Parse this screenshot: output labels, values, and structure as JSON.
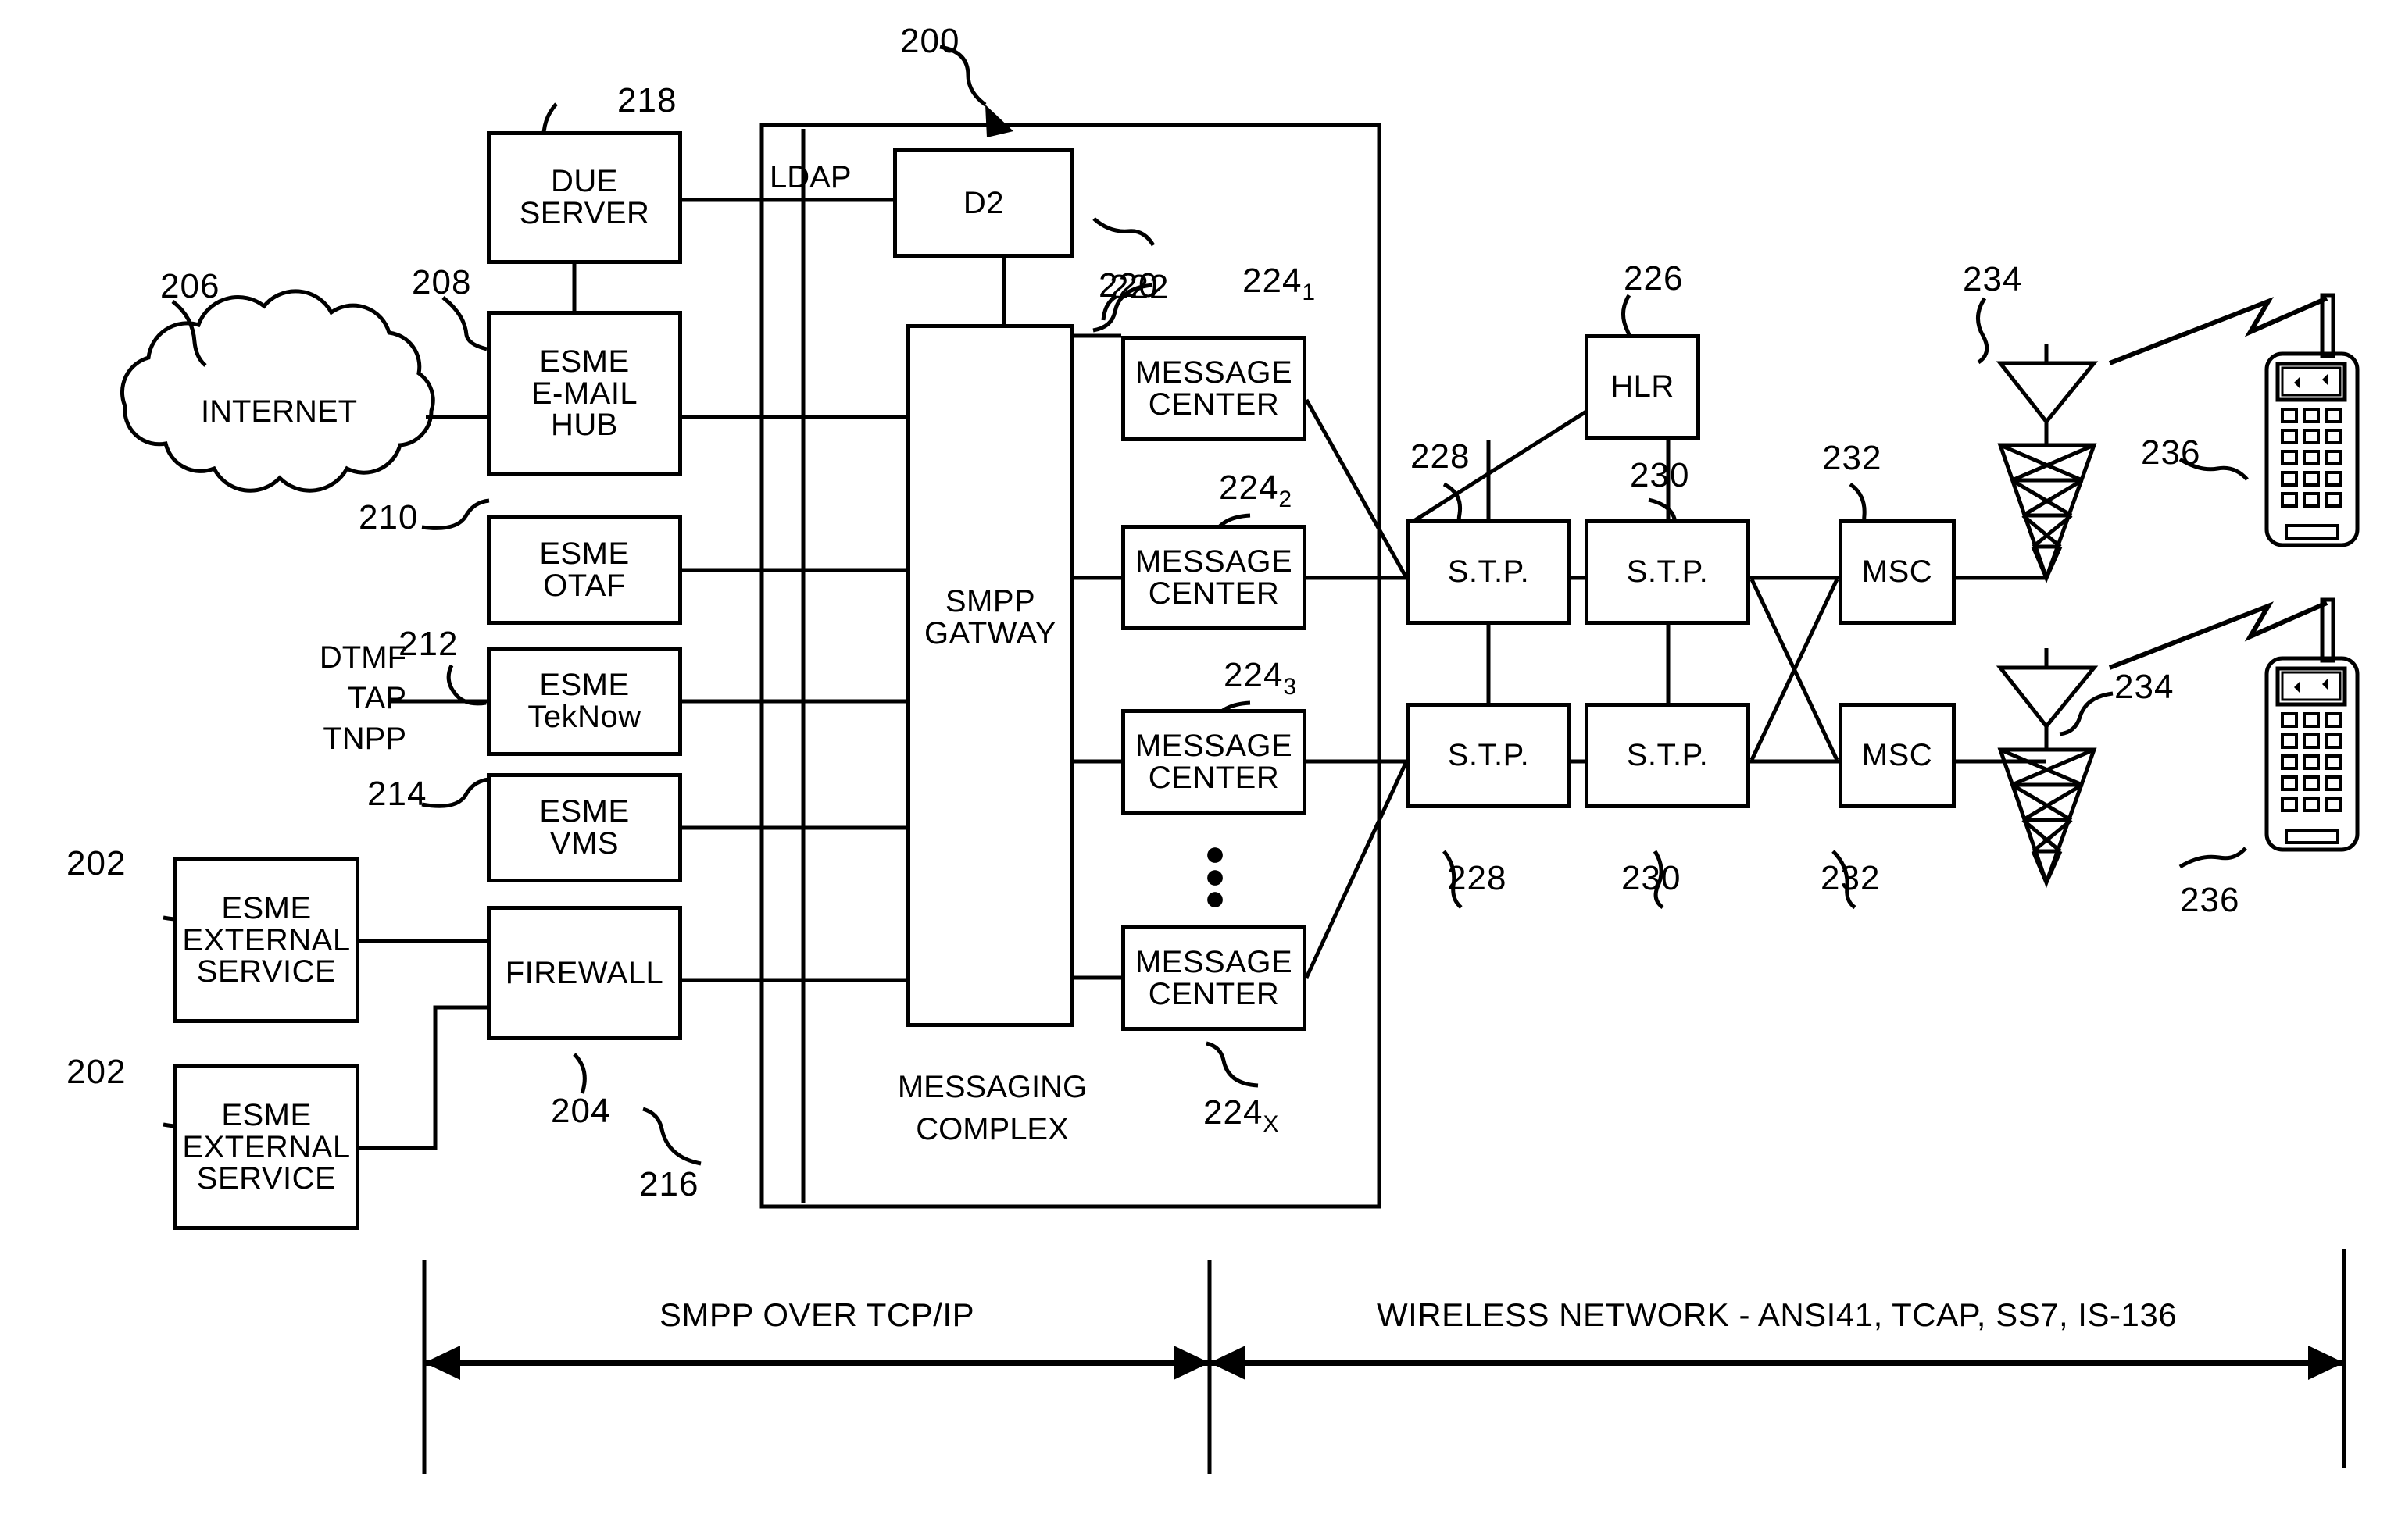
{
  "figure": {
    "system_ref": "200",
    "protocol_left_label": "SMPP OVER TCP/IP",
    "protocol_right_label": "WIRELESS NETWORK - ANSI41, TCAP, SS7, IS-136"
  },
  "nodes": {
    "internet": {
      "label": "INTERNET",
      "ref": "206"
    },
    "due_server": {
      "label": "DUE\nSERVER",
      "ref": "218"
    },
    "d2": {
      "label": "D2",
      "ref": "220"
    },
    "ldap_link": {
      "label": "LDAP"
    },
    "esme_email_hub": {
      "label": "ESME\nE-MAIL\nHUB",
      "ref": "208"
    },
    "esme_otaf": {
      "label": "ESME\nOTAF",
      "ref": "210"
    },
    "esme_teknow": {
      "label": "ESME\nTekNow",
      "ref": "212"
    },
    "esme_vms": {
      "label": "ESME\nVMS",
      "ref": "214"
    },
    "firewall": {
      "label": "FIREWALL",
      "ref": "204"
    },
    "esme_ext_1": {
      "label": "ESME\nEXTERNAL\nSERVICE",
      "ref": "202"
    },
    "esme_ext_2": {
      "label": "ESME\nEXTERNAL\nSERVICE",
      "ref": "202"
    },
    "dtmf_inputs": {
      "label": "DTMF\nTAP\nTNPP"
    },
    "smpp_gateway": {
      "label": "SMPP\nGATWAY",
      "ref": "222"
    },
    "messaging_complex": {
      "label": "MESSAGING\nCOMPLEX",
      "ref": "216"
    },
    "message_center_1": {
      "label": "MESSAGE\nCENTER",
      "ref": "224",
      "sub": "1"
    },
    "message_center_2": {
      "label": "MESSAGE\nCENTER",
      "ref": "224",
      "sub": "2"
    },
    "message_center_3": {
      "label": "MESSAGE\nCENTER",
      "ref": "224",
      "sub": "3"
    },
    "message_center_x": {
      "label": "MESSAGE\nCENTER",
      "ref": "224",
      "sub": "X"
    },
    "stp_top": {
      "label": "S.T.P.",
      "ref": "228"
    },
    "stp_bottom": {
      "label": "S.T.P.",
      "ref": "228"
    },
    "stp2_top": {
      "label": "S.T.P.",
      "ref": "230"
    },
    "stp2_bottom": {
      "label": "S.T.P.",
      "ref": "230"
    },
    "hlr": {
      "label": "HLR",
      "ref": "226"
    },
    "msc_top": {
      "label": "MSC",
      "ref": "232"
    },
    "msc_bottom": {
      "label": "MSC",
      "ref": "232"
    },
    "tower_top": {
      "ref": "234"
    },
    "tower_bottom": {
      "ref": "234"
    },
    "handset_top": {
      "ref": "236"
    },
    "handset_bottom": {
      "ref": "236"
    }
  },
  "refs": {
    "r200": "200",
    "r202a": "202",
    "r202b": "202",
    "r204": "204",
    "r206": "206",
    "r208": "208",
    "r210": "210",
    "r212": "212",
    "r214": "214",
    "r216": "216",
    "r218": "218",
    "r220": "220",
    "r222": "222",
    "r224_1": "224",
    "r224_1s": "1",
    "r224_2": "224",
    "r224_2s": "2",
    "r224_3": "224",
    "r224_3s": "3",
    "r224_x": "224",
    "r224_xs": "X",
    "r226": "226",
    "r228a": "228",
    "r228b": "228",
    "r230a": "230",
    "r230b": "230",
    "r232a": "232",
    "r232b": "232",
    "r234a": "234",
    "r234b": "234",
    "r236a": "236",
    "r236b": "236"
  },
  "labels": {
    "internet": "INTERNET",
    "due_server_l1": "DUE",
    "due_server_l2": "SERVER",
    "ldap": "LDAP",
    "d2": "D2",
    "esme_email_l1": "ESME",
    "esme_email_l2": "E-MAIL",
    "esme_email_l3": "HUB",
    "esme_otaf_l1": "ESME",
    "esme_otaf_l2": "OTAF",
    "esme_teknow_l1": "ESME",
    "esme_teknow_l2": "TekNow",
    "esme_vms_l1": "ESME",
    "esme_vms_l2": "VMS",
    "firewall": "FIREWALL",
    "esme_ext1_l1": "ESME",
    "esme_ext1_l2": "EXTERNAL",
    "esme_ext1_l3": "SERVICE",
    "esme_ext2_l1": "ESME",
    "esme_ext2_l2": "EXTERNAL",
    "esme_ext2_l3": "SERVICE",
    "dtmf": "DTMF",
    "tap": "TAP",
    "tnpp": "TNPP",
    "smpp_l1": "SMPP",
    "smpp_l2": "GATWAY",
    "mc_l1": "MESSAGE",
    "mc_l2": "CENTER",
    "messaging_l1": "MESSAGING",
    "messaging_l2": "COMPLEX",
    "stp": "S.T.P.",
    "hlr": "HLR",
    "msc": "MSC",
    "vdots": "•\n•\n•",
    "smpp_over_tcpip": "SMPP OVER TCP/IP",
    "wireless_network": "WIRELESS NETWORK - ANSI41, TCAP, SS7, IS-136"
  }
}
